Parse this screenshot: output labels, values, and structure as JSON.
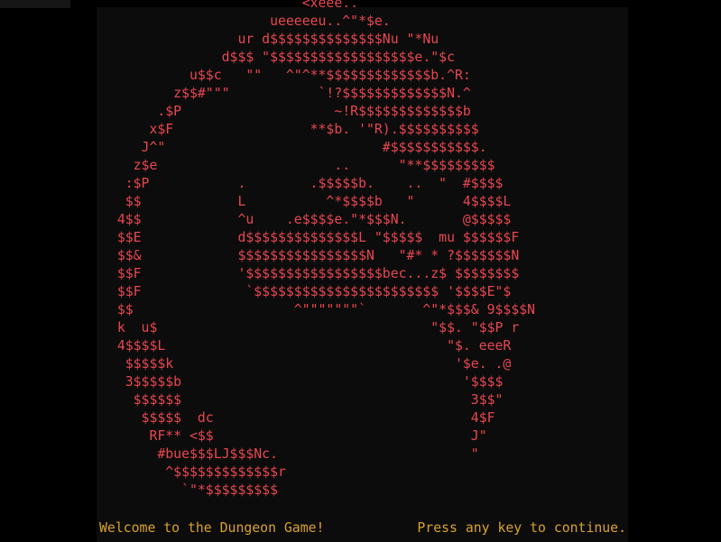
{
  "colors": {
    "art": "#e8474f",
    "status": "#d9a22a",
    "console_bg": "#0c0c0c",
    "frame_bg": "#000000"
  },
  "art_lines": [
    "                         <xeee..",
    "                     ueeeeeu..^\"*$e.",
    "                 ur d$$$$$$$$$$$$$$Nu \"*Nu",
    "               d$$$ \"$$$$$$$$$$$$$$$$$$e.\"$c",
    "           u$$c   \"\"   ^\"^**$$$$$$$$$$$$$b.^R:",
    "         z$$#\"\"\"           `!?$$$$$$$$$$$$$N.^",
    "       .$P                   ~!R$$$$$$$$$$$$$b",
    "      x$F                 **$b. '\"R).$$$$$$$$$$",
    "     J^\"                           #$$$$$$$$$$$.",
    "    z$e                      ..      \"**$$$$$$$$$",
    "   :$P           .        .$$$$$b.    ..  \"  #$$$$",
    "   $$            L          ^*$$$$b   \"      4$$$$L",
    "  4$$            ^u    .e$$$$e.\"*$$$N.       @$$$$$",
    "  $$E            d$$$$$$$$$$$$$$L \"$$$$$  mu $$$$$$F",
    "  $$&            $$$$$$$$$$$$$$$$N   \"#* * ?$$$$$$$N",
    "  $$F            '$$$$$$$$$$$$$$$$$bec...z$ $$$$$$$$",
    "  $$F             `$$$$$$$$$$$$$$$$$$$$$$$ '$$$$E\"$",
    "  $$                    ^\"\"\"\"\"\"\"`       ^\"*$$$& 9$$$$N",
    "  k  u$                                  \"$$. \"$$P r",
    "  4$$$$L                                   \"$. eeeR",
    "   $$$$$k                                   '$e. .@",
    "   3$$$$$b                                   '$$$$",
    "    $$$$$$                                    3$$\"",
    "     $$$$$  dc                                4$F",
    "      RF** <$$                                J\"",
    "       #bue$$$LJ$$$Nc.                        \"",
    "        ^$$$$$$$$$$$$$r",
    "          `\"*$$$$$$$$$"
  ],
  "status": {
    "welcome": "Welcome to the Dungeon Game!",
    "press_key": "Press any key to continue."
  }
}
